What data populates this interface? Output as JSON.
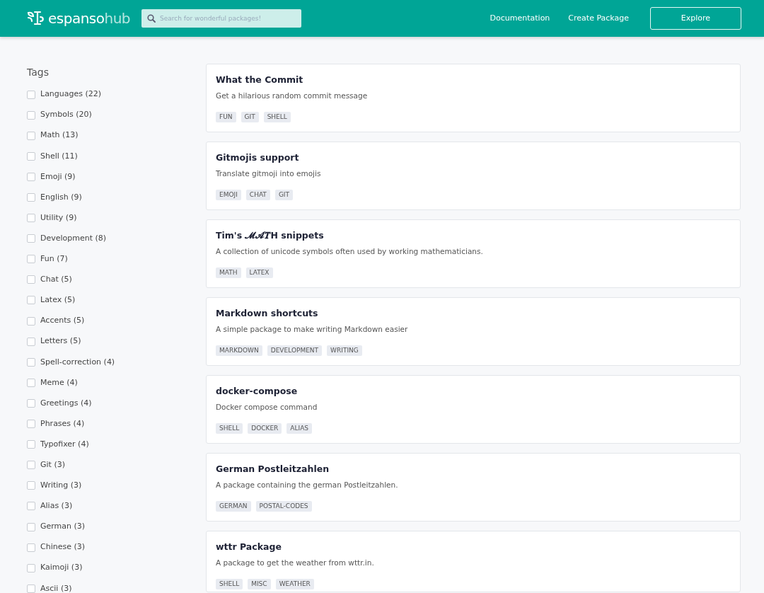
{
  "header": {
    "brand": {
      "main": "espanso",
      "accent": "hub"
    },
    "search": {
      "placeholder": "Search for wonderful packages!"
    },
    "nav": [
      {
        "label": "Documentation",
        "kind": "link"
      },
      {
        "label": "Create Package",
        "kind": "link"
      },
      {
        "label": "Explore",
        "kind": "button"
      }
    ]
  },
  "sidebar": {
    "title": "Tags",
    "tags": [
      {
        "label": "Languages (22)",
        "checked": false
      },
      {
        "label": "Symbols (20)",
        "checked": false
      },
      {
        "label": "Math (13)",
        "checked": false
      },
      {
        "label": "Shell (11)",
        "checked": false
      },
      {
        "label": "Emoji (9)",
        "checked": false
      },
      {
        "label": "English (9)",
        "checked": false
      },
      {
        "label": "Utility (9)",
        "checked": false
      },
      {
        "label": "Development (8)",
        "checked": false
      },
      {
        "label": "Fun (7)",
        "checked": false
      },
      {
        "label": "Chat (5)",
        "checked": false
      },
      {
        "label": "Latex (5)",
        "checked": false
      },
      {
        "label": "Accents (5)",
        "checked": false
      },
      {
        "label": "Letters (5)",
        "checked": false
      },
      {
        "label": "Spell-correction (4)",
        "checked": false
      },
      {
        "label": "Meme (4)",
        "checked": false
      },
      {
        "label": "Greetings (4)",
        "checked": false
      },
      {
        "label": "Phrases (4)",
        "checked": false
      },
      {
        "label": "Typofixer (4)",
        "checked": false
      },
      {
        "label": "Git (3)",
        "checked": false
      },
      {
        "label": "Writing (3)",
        "checked": false
      },
      {
        "label": "Alias (3)",
        "checked": false
      },
      {
        "label": "German (3)",
        "checked": false
      },
      {
        "label": "Chinese (3)",
        "checked": false
      },
      {
        "label": "Kaimoji (3)",
        "checked": false
      },
      {
        "label": "Ascii (3)",
        "checked": false
      }
    ]
  },
  "packages": [
    {
      "title": "What the Commit",
      "description": "Get a hilarious random commit message",
      "tags": [
        "FUN",
        "GIT",
        "SHELL"
      ]
    },
    {
      "title": "Gitmojis support",
      "description": "Translate gitmoji into emojis",
      "tags": [
        "EMOJI",
        "CHAT",
        "GIT"
      ]
    },
    {
      "title": "Tim's 𝓜𝓐𝑻H snippets",
      "description": "A collection of unicode symbols often used by working mathematicians.",
      "tags": [
        "MATH",
        "LATEX"
      ]
    },
    {
      "title": "Markdown shortcuts",
      "description": "A simple package to make writing Markdown easier",
      "tags": [
        "MARKDOWN",
        "DEVELOPMENT",
        "WRITING"
      ]
    },
    {
      "title": "docker-compose",
      "description": "Docker compose command",
      "tags": [
        "SHELL",
        "DOCKER",
        "ALIAS"
      ]
    },
    {
      "title": "German Postleitzahlen",
      "description": "A package containing the german Postleitzahlen.",
      "tags": [
        "GERMAN",
        "POSTAL-CODES"
      ]
    },
    {
      "title": "wttr Package",
      "description": "A package to get the weather from wttr.in.",
      "tags": [
        "SHELL",
        "MISC",
        "WEATHER"
      ]
    }
  ]
}
